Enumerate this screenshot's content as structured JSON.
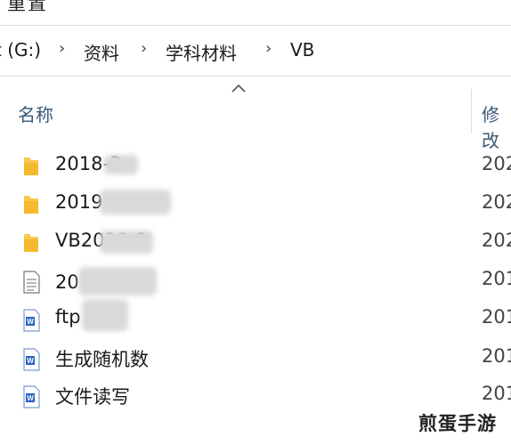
{
  "top": {
    "cut_text": "重置"
  },
  "breadcrumb": {
    "items": [
      {
        "label": "t (G:)"
      },
      {
        "label": "资料"
      },
      {
        "label": "学科材料"
      },
      {
        "label": "VB"
      }
    ],
    "separator": "›"
  },
  "columns": {
    "name": "名称",
    "modified": "修改"
  },
  "files": [
    {
      "name": "2018-3",
      "type": "folder",
      "date": "202"
    },
    {
      "name": "2019",
      "type": "folder",
      "date": "202"
    },
    {
      "name": "VB2020-8",
      "type": "folder",
      "date": "202"
    },
    {
      "name": "20 密码",
      "type": "text",
      "date": "201"
    },
    {
      "name": "ftp",
      "type": "word",
      "date": "201"
    },
    {
      "name": "生成随机数",
      "type": "word",
      "date": "201"
    },
    {
      "name": "文件读写",
      "type": "word",
      "date": "201"
    }
  ],
  "watermark": "煎蛋手游",
  "colors": {
    "folder": "#f8c74d",
    "word_icon": "#2b63c4",
    "header_text": "#3a5a78"
  }
}
